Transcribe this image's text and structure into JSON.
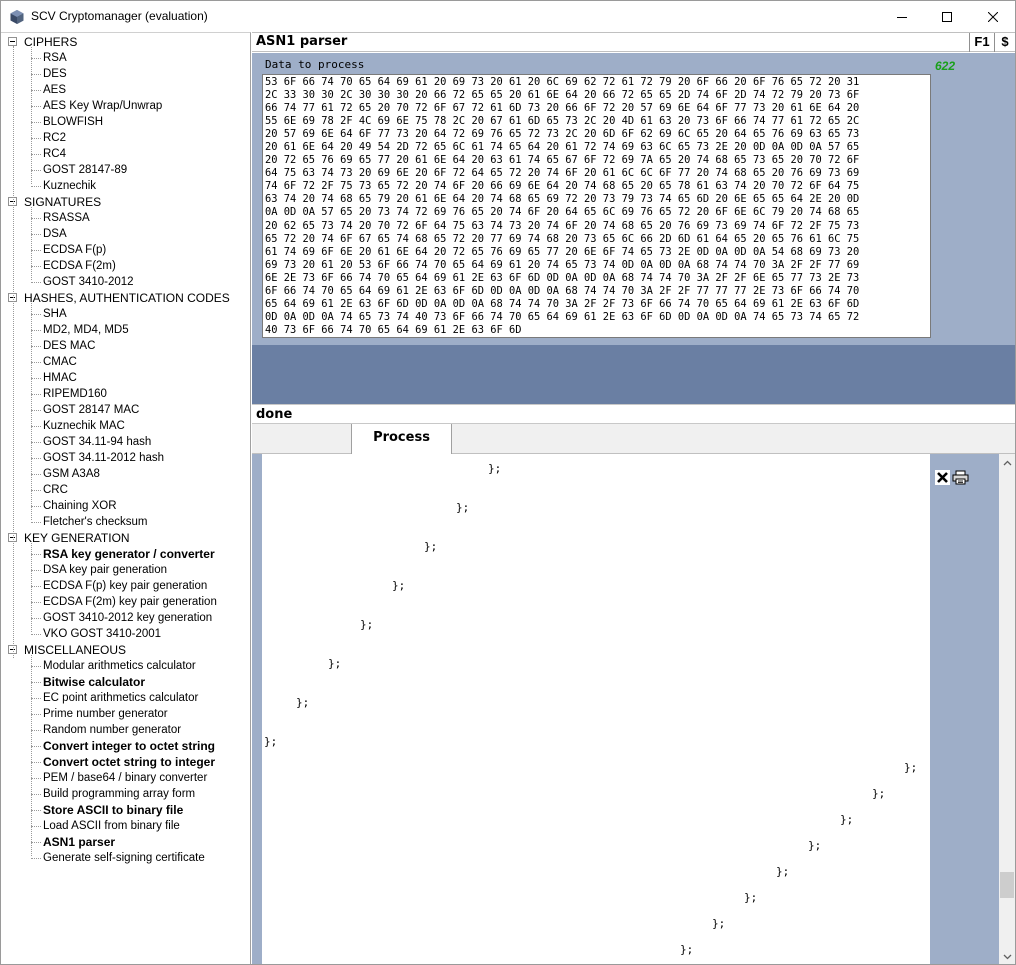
{
  "window": {
    "title": "SCV Cryptomanager (evaluation)"
  },
  "tree": {
    "groups": [
      {
        "label": "CIPHERS",
        "items": [
          {
            "label": "RSA",
            "bold": false
          },
          {
            "label": "DES",
            "bold": false
          },
          {
            "label": "AES",
            "bold": false
          },
          {
            "label": "AES Key Wrap/Unwrap",
            "bold": false
          },
          {
            "label": "BLOWFISH",
            "bold": false
          },
          {
            "label": "RC2",
            "bold": false
          },
          {
            "label": "RC4",
            "bold": false
          },
          {
            "label": "GOST 28147-89",
            "bold": false
          },
          {
            "label": "Kuznechik",
            "bold": false
          }
        ]
      },
      {
        "label": "SIGNATURES",
        "items": [
          {
            "label": "RSASSA",
            "bold": false
          },
          {
            "label": "DSA",
            "bold": false
          },
          {
            "label": "ECDSA F(p)",
            "bold": false
          },
          {
            "label": "ECDSA F(2m)",
            "bold": false
          },
          {
            "label": "GOST 3410-2012",
            "bold": false
          }
        ]
      },
      {
        "label": "HASHES, AUTHENTICATION CODES",
        "items": [
          {
            "label": "SHA",
            "bold": false
          },
          {
            "label": "MD2, MD4, MD5",
            "bold": false
          },
          {
            "label": "DES MAC",
            "bold": false
          },
          {
            "label": "CMAC",
            "bold": false
          },
          {
            "label": "HMAC",
            "bold": false
          },
          {
            "label": "RIPEMD160",
            "bold": false
          },
          {
            "label": "GOST 28147 MAC",
            "bold": false
          },
          {
            "label": "Kuznechik MAC",
            "bold": false
          },
          {
            "label": "GOST 34.11-94 hash",
            "bold": false
          },
          {
            "label": "GOST 34.11-2012 hash",
            "bold": false
          },
          {
            "label": "GSM A3A8",
            "bold": false
          },
          {
            "label": "CRC",
            "bold": false
          },
          {
            "label": "Chaining XOR",
            "bold": false
          },
          {
            "label": "Fletcher's checksum",
            "bold": false
          }
        ]
      },
      {
        "label": "KEY GENERATION",
        "items": [
          {
            "label": "RSA key generator / converter",
            "bold": true
          },
          {
            "label": "DSA key pair generation",
            "bold": false
          },
          {
            "label": "ECDSA F(p) key pair generation",
            "bold": false
          },
          {
            "label": "ECDSA F(2m) key pair generation",
            "bold": false
          },
          {
            "label": "GOST 3410-2012 key generation",
            "bold": false
          },
          {
            "label": "VKO GOST 3410-2001",
            "bold": false
          }
        ]
      },
      {
        "label": "MISCELLANEOUS",
        "items": [
          {
            "label": "Modular arithmetics calculator",
            "bold": false
          },
          {
            "label": "Bitwise calculator",
            "bold": true
          },
          {
            "label": "EC point arithmetics calculator",
            "bold": false
          },
          {
            "label": "Prime number generator",
            "bold": false
          },
          {
            "label": "Random number generator",
            "bold": false
          },
          {
            "label": "Convert integer to octet string",
            "bold": true
          },
          {
            "label": "Convert octet string to integer",
            "bold": true
          },
          {
            "label": "PEM / base64 / binary converter",
            "bold": false
          },
          {
            "label": "Build programming array form",
            "bold": false
          },
          {
            "label": "Store ASCII to binary file",
            "bold": true
          },
          {
            "label": "Load ASCII from binary file",
            "bold": false
          },
          {
            "label": "ASN1 parser",
            "bold": true
          },
          {
            "label": "Generate self-signing certificate",
            "bold": false
          }
        ]
      }
    ]
  },
  "panel": {
    "title": "ASN1 parser",
    "help_label": "F1",
    "price_label": "$"
  },
  "input": {
    "label": "Data to process",
    "byte_count": "622",
    "hex_lines": [
      "53 6F 66 74 70 65 64 69 61 20 69 73 20 61 20 6C 69 62 72 61 72 79 20 6F 66 20 6F 76 65 72 20 31",
      "2C 33 30 30 2C 30 30 30 20 66 72 65 65 20 61 6E 64 20 66 72 65 65 2D 74 6F 2D 74 72 79 20 73 6F",
      "66 74 77 61 72 65 20 70 72 6F 67 72 61 6D 73 20 66 6F 72 20 57 69 6E 64 6F 77 73 20 61 6E 64 20",
      "55 6E 69 78 2F 4C 69 6E 75 78 2C 20 67 61 6D 65 73 2C 20 4D 61 63 20 73 6F 66 74 77 61 72 65 2C",
      "20 57 69 6E 64 6F 77 73 20 64 72 69 76 65 72 73 2C 20 6D 6F 62 69 6C 65 20 64 65 76 69 63 65 73",
      "20 61 6E 64 20 49 54 2D 72 65 6C 61 74 65 64 20 61 72 74 69 63 6C 65 73 2E 20 0D 0A 0D 0A 57 65",
      "20 72 65 76 69 65 77 20 61 6E 64 20 63 61 74 65 67 6F 72 69 7A 65 20 74 68 65 73 65 20 70 72 6F",
      "64 75 63 74 73 20 69 6E 20 6F 72 64 65 72 20 74 6F 20 61 6C 6C 6F 77 20 74 68 65 20 76 69 73 69",
      "74 6F 72 2F 75 73 65 72 20 74 6F 20 66 69 6E 64 20 74 68 65 20 65 78 61 63 74 20 70 72 6F 64 75",
      "63 74 20 74 68 65 79 20 61 6E 64 20 74 68 65 69 72 20 73 79 73 74 65 6D 20 6E 65 65 64 2E 20 0D",
      "0A 0D 0A 57 65 20 73 74 72 69 76 65 20 74 6F 20 64 65 6C 69 76 65 72 20 6F 6E 6C 79 20 74 68 65",
      "20 62 65 73 74 20 70 72 6F 64 75 63 74 73 20 74 6F 20 74 68 65 20 76 69 73 69 74 6F 72 2F 75 73",
      "65 72 20 74 6F 67 65 74 68 65 72 20 77 69 74 68 20 73 65 6C 66 2D 6D 61 64 65 20 65 76 61 6C 75",
      "61 74 69 6F 6E 20 61 6E 64 20 72 65 76 69 65 77 20 6E 6F 74 65 73 2E 0D 0A 0D 0A 54 68 69 73 20",
      "69 73 20 61 20 53 6F 66 74 70 65 64 69 61 20 74 65 73 74 0D 0A 0D 0A 68 74 74 70 3A 2F 2F 77 69",
      "6E 2E 73 6F 66 74 70 65 64 69 61 2E 63 6F 6D 0D 0A 0D 0A 68 74 74 70 3A 2F 2F 6E 65 77 73 2E 73",
      "6F 66 74 70 65 64 69 61 2E 63 6F 6D 0D 0A 0D 0A 68 74 74 70 3A 2F 2F 77 77 77 2E 73 6F 66 74 70",
      "65 64 69 61 2E 63 6F 6D 0D 0A 0D 0A 68 74 74 70 3A 2F 2F 73 6F 66 74 70 65 64 69 61 2E 63 6F 6D",
      "0D 0A 0D 0A 74 65 73 74 40 73 6F 66 74 70 65 64 69 61 2E 63 6F 6D 0D 0A 0D 0A 74 65 73 74 65 72",
      "40 73 6F 66 74 70 65 64 69 61 2E 63 6F 6D"
    ]
  },
  "status": {
    "text": "done"
  },
  "tabs": {
    "process_label": "Process"
  },
  "output": {
    "lines": [
      "};",
      "};",
      "};",
      "};",
      "};",
      "};",
      "};",
      "};",
      "};",
      "};",
      "};",
      "};",
      "};",
      "};",
      "};",
      "};"
    ]
  },
  "icons": {
    "app": "app-cube-icon",
    "clear": "clear-x-icon",
    "print": "printer-icon"
  },
  "colors": {
    "panel_bg": "#9eaec8",
    "mid_band": "#6a7fa3",
    "byte_count": "#1aa01a"
  }
}
